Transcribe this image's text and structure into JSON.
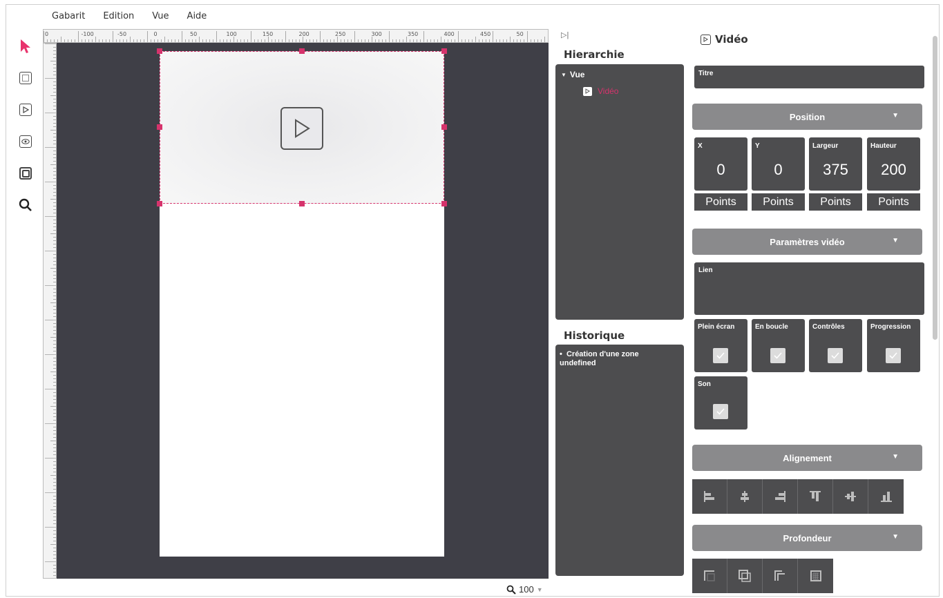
{
  "menu": {
    "items": [
      "Gabarit",
      "Edition",
      "Vue",
      "Aide"
    ]
  },
  "toolbar": {
    "tools": [
      "pointer-icon",
      "rectangle-icon",
      "video-icon",
      "eye-icon",
      "layers-icon",
      "search-icon"
    ]
  },
  "ruler": {
    "top_labels": [
      "0",
      "-100",
      "-50",
      "0",
      "50",
      "100",
      "150",
      "200",
      "250",
      "300",
      "350",
      "400",
      "450",
      "50"
    ]
  },
  "zoom": {
    "value": "100"
  },
  "hierarchy": {
    "title": "Hierarchie",
    "root": "Vue",
    "child": "Vidéo"
  },
  "history": {
    "title": "Historique",
    "items": [
      "Création d'une zone undefined"
    ]
  },
  "properties": {
    "title": "Vidéo",
    "titre_label": "Titre",
    "sections": {
      "position": "Position",
      "video_params": "Paramètres vidéo",
      "alignment": "Alignement",
      "depth": "Profondeur"
    },
    "position": {
      "fields": [
        {
          "label": "X",
          "value": "0",
          "unit": "Points"
        },
        {
          "label": "Y",
          "value": "0",
          "unit": "Points"
        },
        {
          "label": "Largeur",
          "value": "375",
          "unit": "Points"
        },
        {
          "label": "Hauteur",
          "value": "200",
          "unit": "Points"
        }
      ]
    },
    "video": {
      "lien_label": "Lien",
      "options": [
        {
          "label": "Plein écran",
          "checked": true
        },
        {
          "label": "En boucle",
          "checked": true
        },
        {
          "label": "Contrôles",
          "checked": true
        },
        {
          "label": "Progression",
          "checked": true
        },
        {
          "label": "Son",
          "checked": true
        }
      ]
    },
    "alignment_buttons": [
      "align-left-icon",
      "align-center-h-icon",
      "align-right-icon",
      "align-top-icon",
      "align-center-v-icon",
      "align-bottom-icon"
    ],
    "depth_buttons": [
      "bring-front-icon",
      "bring-forward-icon",
      "send-backward-icon",
      "send-back-icon"
    ]
  },
  "colors": {
    "accent": "#d6336c",
    "canvas": "#3f3f47",
    "panel": "#4d4d4f",
    "section": "#8a8a8c"
  }
}
